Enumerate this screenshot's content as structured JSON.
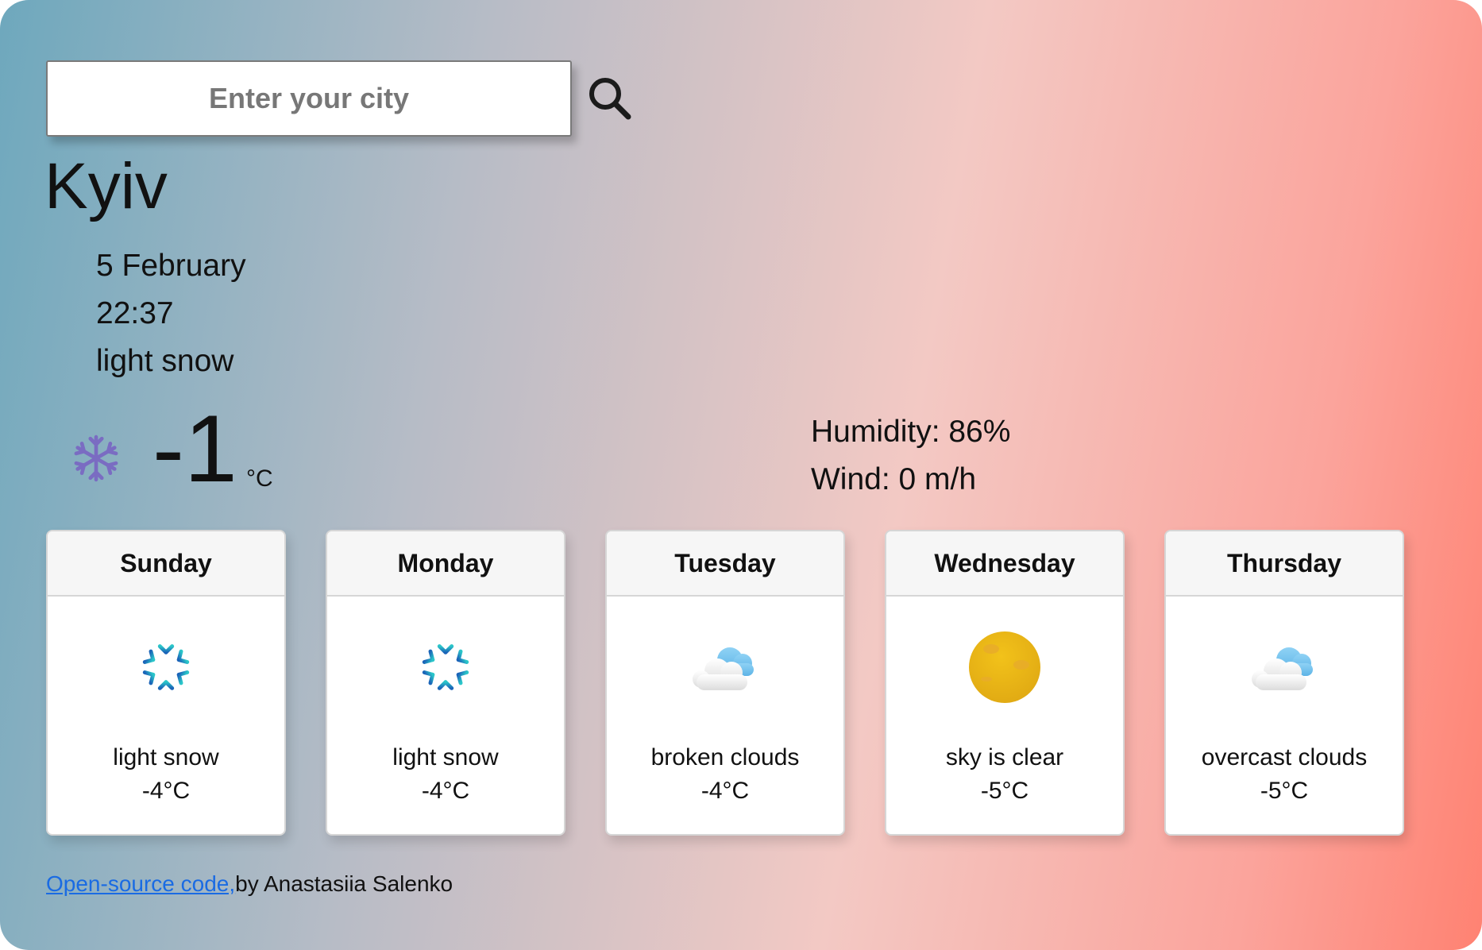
{
  "search": {
    "placeholder": "Enter your city",
    "icon": "search-icon"
  },
  "current": {
    "city": "Kyiv",
    "date": "5 February",
    "time": "22:37",
    "description": "light snow",
    "icon": "snowflake-icon",
    "temperature": "-1",
    "unit": "°C",
    "humidity": "Humidity: 86%",
    "wind": "Wind: 0 m/h"
  },
  "forecast": [
    {
      "day": "Sunday",
      "icon": "snowflake-icon",
      "description": "light snow",
      "temp": "-4°C"
    },
    {
      "day": "Monday",
      "icon": "snowflake-icon",
      "description": "light snow",
      "temp": "-4°C"
    },
    {
      "day": "Tuesday",
      "icon": "cloud-icon",
      "description": "broken clouds",
      "temp": "-4°C"
    },
    {
      "day": "Wednesday",
      "icon": "moon-icon",
      "description": "sky is clear",
      "temp": "-5°C"
    },
    {
      "day": "Thursday",
      "icon": "cloud-icon",
      "description": "overcast clouds",
      "temp": "-5°C"
    }
  ],
  "footer": {
    "link_text": "Open-source code,",
    "author_text": "by Anastasiia Salenko"
  },
  "colors": {
    "gradient_start": "#6ea8bd",
    "gradient_end": "#ff8272",
    "link": "#1a6be3"
  }
}
